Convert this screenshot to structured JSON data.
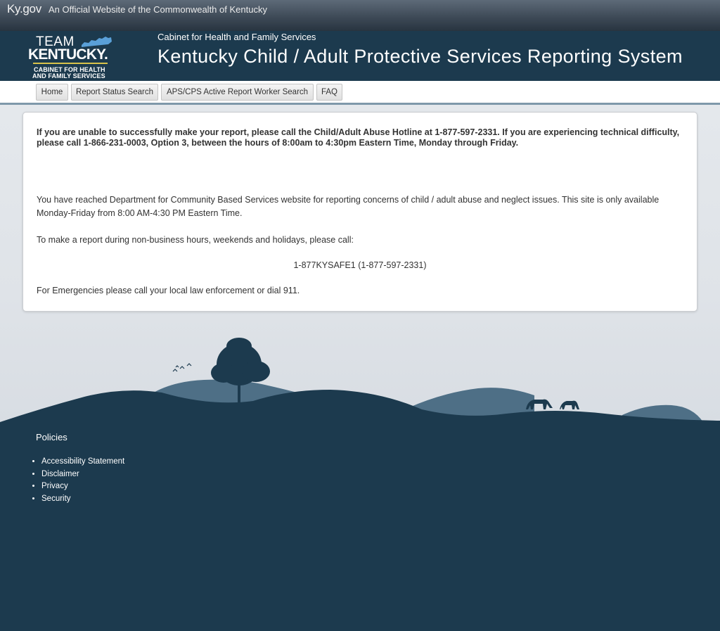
{
  "kygov_bar": {
    "logo_text": "Ky.gov",
    "official_text": "An Official Website of the Commonwealth of Kentucky"
  },
  "header": {
    "logo": {
      "team": "TEAM",
      "kentucky": "KENTUCKY.",
      "cabinet_line1": "CABINET FOR HEALTH",
      "cabinet_line2": "AND FAMILY SERVICES"
    },
    "cabinet_name": "Cabinet for Health and Family Services",
    "title": "Kentucky Child / Adult Protective Services Reporting System"
  },
  "nav": {
    "items": [
      {
        "label": "Home"
      },
      {
        "label": "Report Status Search"
      },
      {
        "label": "APS/CPS Active Report Worker Search"
      },
      {
        "label": "FAQ"
      }
    ]
  },
  "main": {
    "notice": "If you are unable to successfully make your report, please call the Child/Adult Abuse Hotline at 1-877-597-2331. If you are experiencing technical difficulty, please call 1-866-231-0003, Option 3, between the hours of 8:00am to 4:30pm Eastern Time, Monday through Friday.",
    "intro": "You have reached Department for Community Based Services website for reporting concerns of child / adult abuse and neglect issues. This site is only available Monday-Friday from 8:00 AM-4:30 PM Eastern Time.",
    "make_report": "To make a report during non-business hours, weekends and holidays, please call:",
    "hotline": "1-877KYSAFE1 (1-877-597-2331)",
    "emergency": "For Emergencies please call your local law enforcement or dial 911."
  },
  "footer": {
    "heading": "Policies",
    "links": [
      {
        "label": "Accessibility Statement"
      },
      {
        "label": "Disclaimer"
      },
      {
        "label": "Privacy"
      },
      {
        "label": "Security"
      }
    ]
  },
  "colors": {
    "header_bg": "#1c3a4e",
    "accent_gold": "#d8c24a",
    "state_icon": "#5aa0d8",
    "hills_light": "#4e6f86",
    "hills_dark": "#1c3a4e"
  }
}
